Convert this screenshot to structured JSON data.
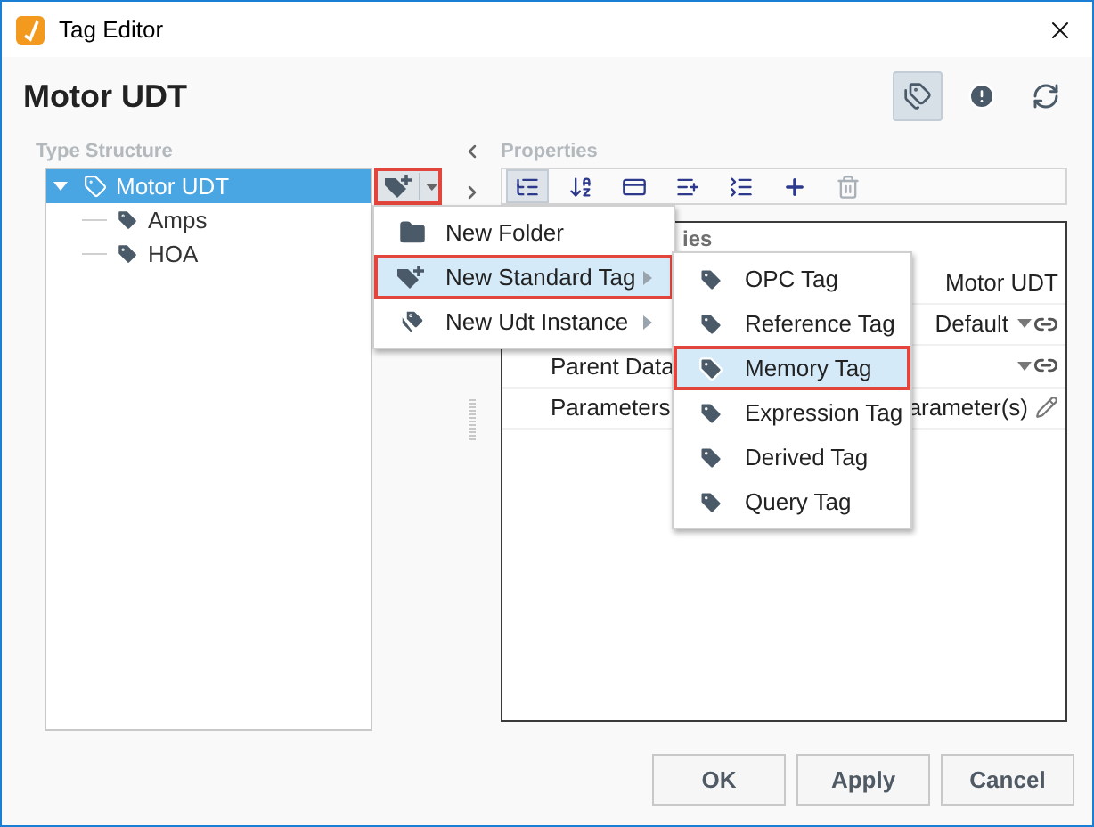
{
  "window": {
    "title": "Tag Editor"
  },
  "header": {
    "title": "Motor UDT",
    "tools": [
      {
        "kind": "tags",
        "selected": true
      },
      {
        "kind": "alert",
        "selected": false
      },
      {
        "kind": "refresh",
        "selected": false
      }
    ]
  },
  "type_structure": {
    "label": "Type Structure",
    "tree": [
      {
        "label": "Motor UDT",
        "kind": "udt",
        "selected": true,
        "expanded": true,
        "children": [
          {
            "label": "Amps",
            "kind": "tag",
            "selected": false
          },
          {
            "label": "HOA",
            "kind": "tag",
            "selected": false
          }
        ]
      }
    ]
  },
  "properties": {
    "label": "Properties",
    "toolbar": [
      {
        "kind": "categorized",
        "selected": true,
        "disabled": false
      },
      {
        "kind": "alphabetical",
        "selected": false,
        "disabled": false
      },
      {
        "kind": "description",
        "selected": false,
        "disabled": false
      },
      {
        "kind": "expand",
        "selected": false,
        "disabled": false
      },
      {
        "kind": "collapse",
        "selected": false,
        "disabled": false
      },
      {
        "kind": "add",
        "selected": false,
        "disabled": false
      },
      {
        "kind": "delete",
        "selected": false,
        "disabled": true
      }
    ],
    "heading": "ies",
    "rows": [
      {
        "value": "Motor UDT",
        "kind": "plain"
      },
      {
        "value": "Default",
        "kind": "binding"
      },
      {
        "name": "Parent Data",
        "kind": "binding"
      },
      {
        "name": "Parameters",
        "value": "arameter(s)",
        "kind": "editable"
      }
    ]
  },
  "menu": {
    "items": [
      {
        "label": "New Folder",
        "kind": "folder",
        "selected": false,
        "submenu": false
      },
      {
        "label": "New Standard Tag",
        "kind": "tag-plus",
        "selected": true,
        "submenu": true
      },
      {
        "label": "New Udt Instance",
        "kind": "udt",
        "selected": false,
        "submenu": true
      }
    ]
  },
  "submenu": {
    "items": [
      {
        "label": "OPC Tag",
        "selected": false
      },
      {
        "label": "Reference Tag",
        "selected": false
      },
      {
        "label": "Memory Tag",
        "selected": true
      },
      {
        "label": "Expression Tag",
        "selected": false
      },
      {
        "label": "Derived Tag",
        "selected": false
      },
      {
        "label": "Query Tag",
        "selected": false
      }
    ]
  },
  "buttons": [
    "OK",
    "Apply",
    "Cancel"
  ]
}
